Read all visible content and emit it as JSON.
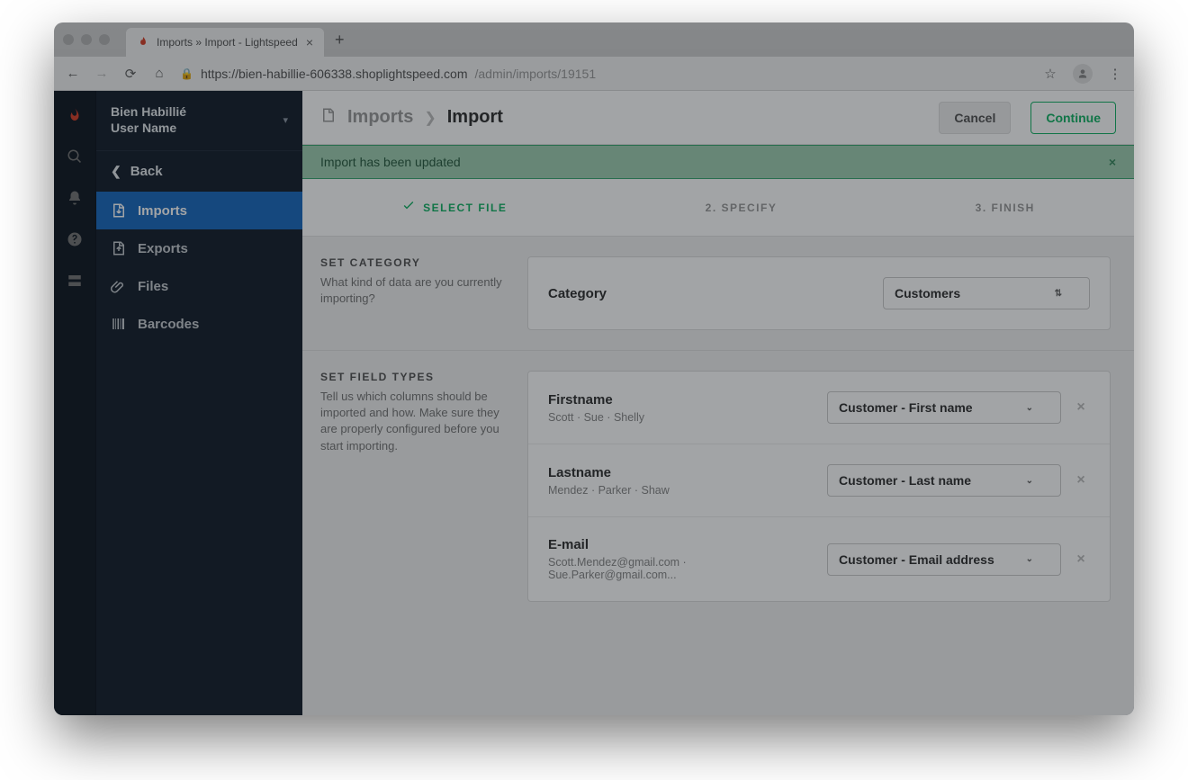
{
  "browser": {
    "tab_title": "Imports » Import - Lightspeed",
    "url_host": "https://bien-habillie-606338.shoplightspeed.com",
    "url_path": "/admin/imports/19151"
  },
  "sidebar": {
    "company": "Bien Habillié",
    "username": "User Name",
    "back": "Back",
    "items": [
      {
        "label": "Imports"
      },
      {
        "label": "Exports"
      },
      {
        "label": "Files"
      },
      {
        "label": "Barcodes"
      }
    ]
  },
  "header": {
    "breadcrumb_parent": "Imports",
    "breadcrumb_current": "Import",
    "cancel": "Cancel",
    "continue": "Continue"
  },
  "alert": {
    "message": "Import has been updated"
  },
  "steps": {
    "s1": "SELECT FILE",
    "s2": "2. SPECIFY",
    "s3": "3. FINISH"
  },
  "category_section": {
    "title": "SET CATEGORY",
    "desc": "What kind of data are you currently importing?",
    "label": "Category",
    "value": "Customers"
  },
  "fields_section": {
    "title": "SET FIELD TYPES",
    "desc": "Tell us which columns should be imported and how. Make sure they are properly configured before you start importing.",
    "rows": [
      {
        "name": "Firstname",
        "sample": "Scott · Sue · Shelly",
        "mapping": "Customer - First name"
      },
      {
        "name": "Lastname",
        "sample": "Mendez · Parker · Shaw",
        "mapping": "Customer - Last name"
      },
      {
        "name": "E-mail",
        "sample": "Scott.Mendez@gmail.com · Sue.Parker@gmail.com...",
        "mapping": "Customer - Email address"
      }
    ]
  }
}
